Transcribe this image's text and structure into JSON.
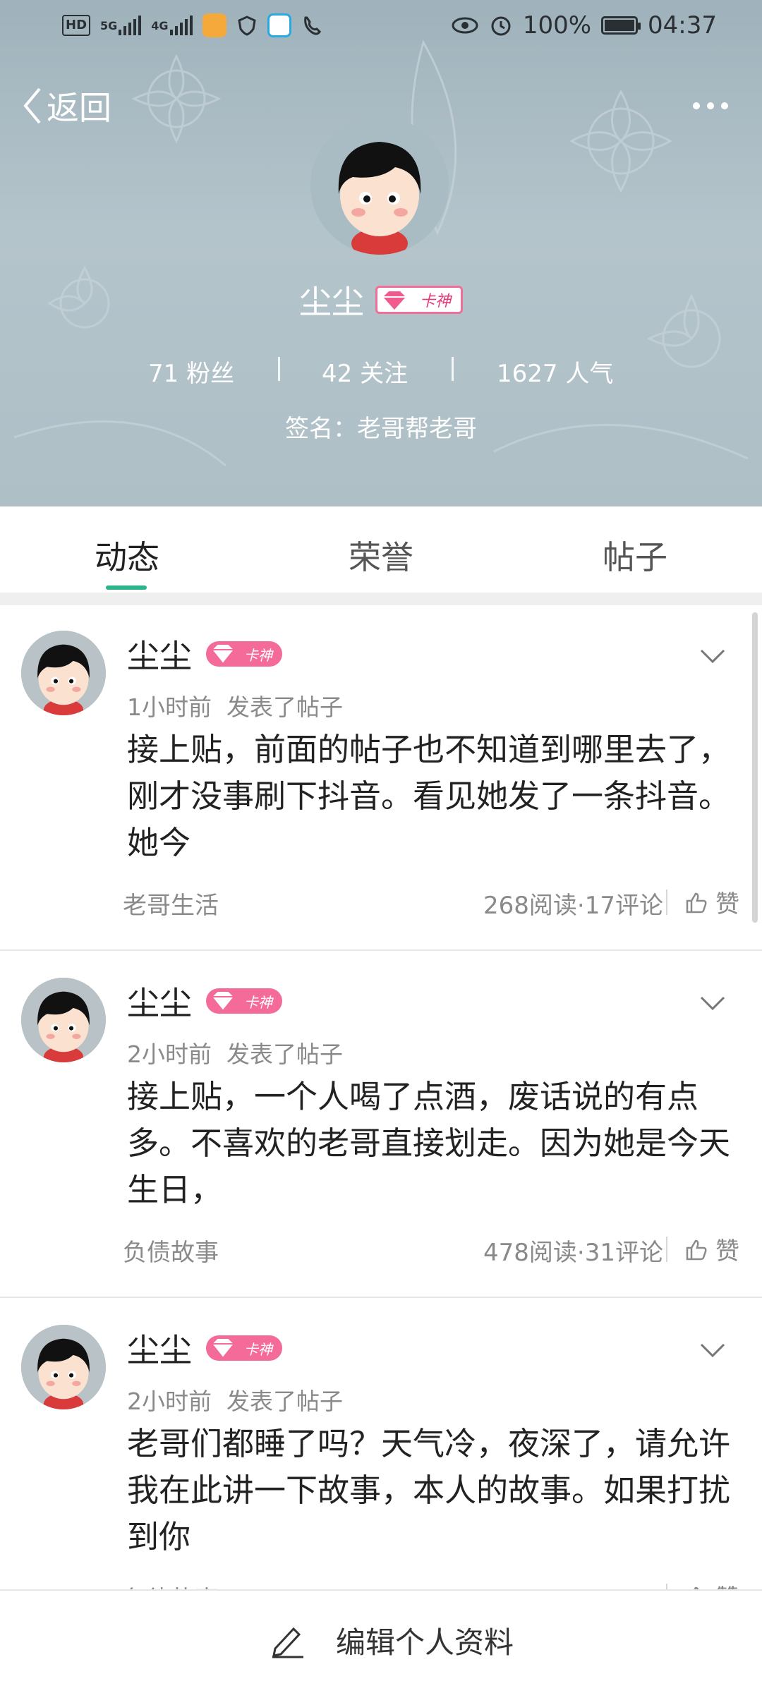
{
  "status_bar": {
    "network_left": "HD",
    "sim1": "5G",
    "sim2": "4G",
    "battery": "100%",
    "time": "04:37"
  },
  "header": {
    "back_label": "返回",
    "username": "尘尘",
    "badge_text": "卡神",
    "stats": {
      "fans": "71 粉丝",
      "following": "42 关注",
      "popularity": "1627 人气"
    },
    "signature": "签名：老哥帮老哥"
  },
  "tabs": [
    "动态",
    "荣誉",
    "帖子"
  ],
  "active_tab": 0,
  "posts": [
    {
      "username": "尘尘",
      "badge": "卡神",
      "time": "1小时前",
      "action": "发表了帖子",
      "content": "接上贴，前面的帖子也不知道到哪里去了，刚才没事刷下抖音。看见她发了一条抖音。她今",
      "category": "老哥生活",
      "stats": "268阅读·17评论",
      "like": "赞"
    },
    {
      "username": "尘尘",
      "badge": "卡神",
      "time": "2小时前",
      "action": "发表了帖子",
      "content": "接上贴，一个人喝了点酒，废话说的有点多。不喜欢的老哥直接划走。因为她是今天生日，",
      "category": "负债故事",
      "stats": "478阅读·31评论",
      "like": "赞"
    },
    {
      "username": "尘尘",
      "badge": "卡神",
      "time": "2小时前",
      "action": "发表了帖子",
      "content": "老哥们都睡了吗？天气冷，夜深了，请允许我在此讲一下故事，本人的故事。如果打扰到你",
      "category": "负债故事",
      "stats": "",
      "like": "赞"
    }
  ],
  "bottom": {
    "edit_label": "编辑个人资料"
  },
  "colors": {
    "accent": "#2bb38c",
    "badge_pink": "#f46a98",
    "header_bg": "#aebfc6"
  },
  "icons": [
    "back-chevron-icon",
    "more-dots-icon",
    "gem-icon",
    "chevron-down-icon",
    "thumbs-up-icon",
    "pencil-icon"
  ]
}
